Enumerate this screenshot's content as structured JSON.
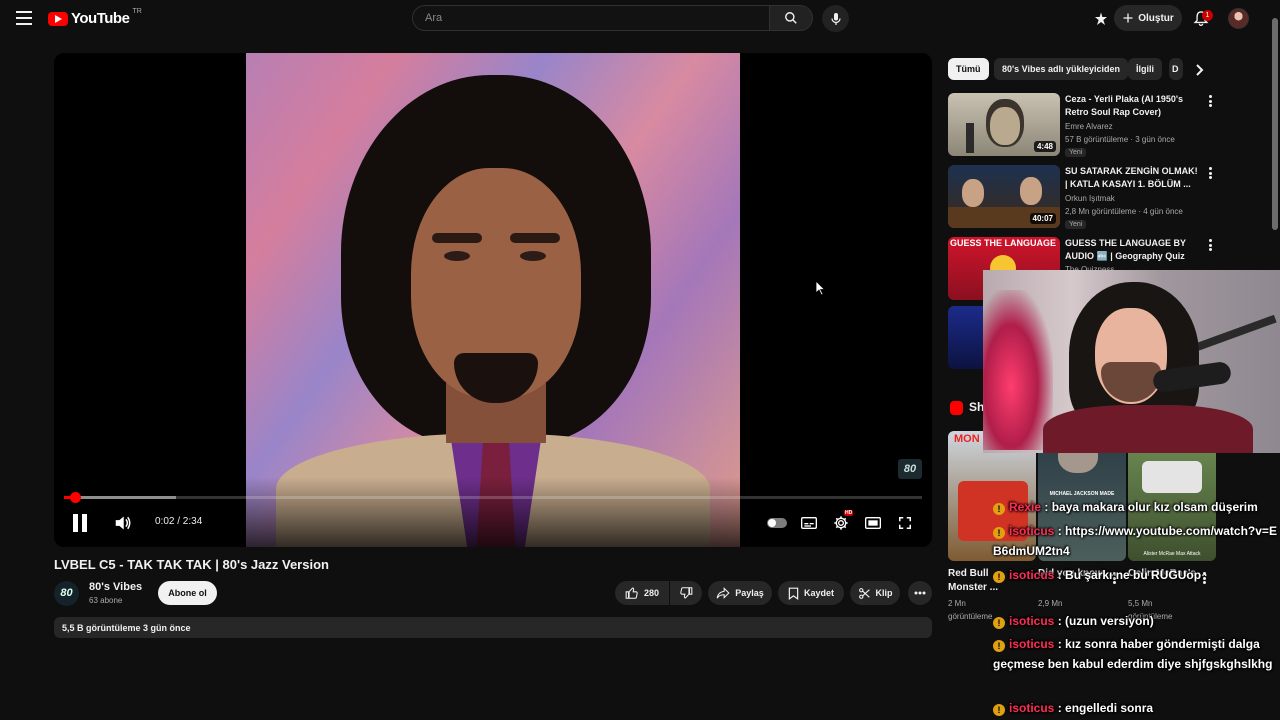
{
  "header": {
    "logo_text": "YouTube",
    "country_code": "TR",
    "search_placeholder": "Ara",
    "create_label": "Oluştur",
    "notification_count": "1"
  },
  "video": {
    "title": "LVBEL C5 - TAK TAK TAK | 80's Jazz Version",
    "time_current": "0:02",
    "time_total": "2:34",
    "time_display": "0:02 / 2:34",
    "progress_fraction": 0.013,
    "buffered_fraction": 0.13,
    "watermark": "80",
    "hd_badge": "HD"
  },
  "channel": {
    "avatar_text": "80",
    "name": "80's Vibes",
    "subscribers": "63 abone",
    "subscribe_label": "Abone ol"
  },
  "actions": {
    "like_count": "280",
    "share_label": "Paylaş",
    "save_label": "Kaydet",
    "clip_label": "Klip"
  },
  "description": {
    "stats": "5,5 B görüntüleme  3 gün önce"
  },
  "chips": [
    {
      "label": "Tümü",
      "active": true
    },
    {
      "label": "80's Vibes adlı yükleyiciden",
      "active": false
    },
    {
      "label": "İlgili",
      "active": false
    },
    {
      "label": "D",
      "active": false
    }
  ],
  "recommendations": [
    {
      "title": "Ceza - Yerli Plaka (AI 1950's Retro Soul Rap Cover)",
      "channel": "Emre Alvarez",
      "meta": "57 B görüntüleme · 3 gün önce",
      "duration": "4:48",
      "badge": "Yeni"
    },
    {
      "title": "SU SATARAK ZENGİN OLMAK! | KATLA KASAYI 1. BÖLÜM ...",
      "channel": "Orkun Işıtmak",
      "meta": "2,8 Mn görüntüleme · 4 gün önce",
      "duration": "40:07",
      "badge": "Yeni"
    },
    {
      "title": "GUESS THE LANGUAGE BY AUDIO 🔤 | Geography Quiz",
      "channel": "The Quizness",
      "meta": "",
      "duration": "",
      "badge": "",
      "thumb_text": "GUESS THE LANGUAGE"
    }
  ],
  "shorts": {
    "section_title": "Shorts",
    "items": [
      {
        "title": "Red Bull Monster ...",
        "views": "2 Mn",
        "extra": "görüntüleme",
        "thumb_text": "MON"
      },
      {
        "title": "Did you know, ...",
        "views": "2,9 Mn",
        "extra": "görüntüleme",
        "thumb_text": "MICHAEL JACKSON MADE"
      },
      {
        "title": "Colin McRae's ...",
        "views": "5,5 Mn",
        "extra": "görüntüleme",
        "thumb_text": "Alister McRae Max Attack"
      }
    ]
  },
  "chat": [
    {
      "user": "Rexie",
      "text": "baya makara olur kız olsam düşerim"
    },
    {
      "user": "isoticus",
      "text": "https://www.youtube.com/watch?v=EB6dmUM2tn4"
    },
    {
      "user": "isoticus",
      "text": "Bu şarkı ne bu RUGUop"
    },
    {
      "user": "isoticus",
      "text": "(uzun versiyon)"
    },
    {
      "user": "isoticus",
      "text": "kız sonra haber göndermişti dalga geçmese ben kabul ederdim diye shjfgskghslkhg"
    },
    {
      "user": "isoticus",
      "text": "engelledi sonra"
    }
  ],
  "colors": {
    "brand_red": "#ff0000",
    "background": "#0f0f0f",
    "chip_bg": "#272727",
    "chat_user": "#ff2d55",
    "chat_badge": "#e0a010"
  },
  "icons": {
    "menu": "hamburger-menu-icon",
    "search": "search-icon",
    "mic": "mic-icon",
    "shorts_logo": "shorts-icon",
    "settings": "gear-icon"
  }
}
